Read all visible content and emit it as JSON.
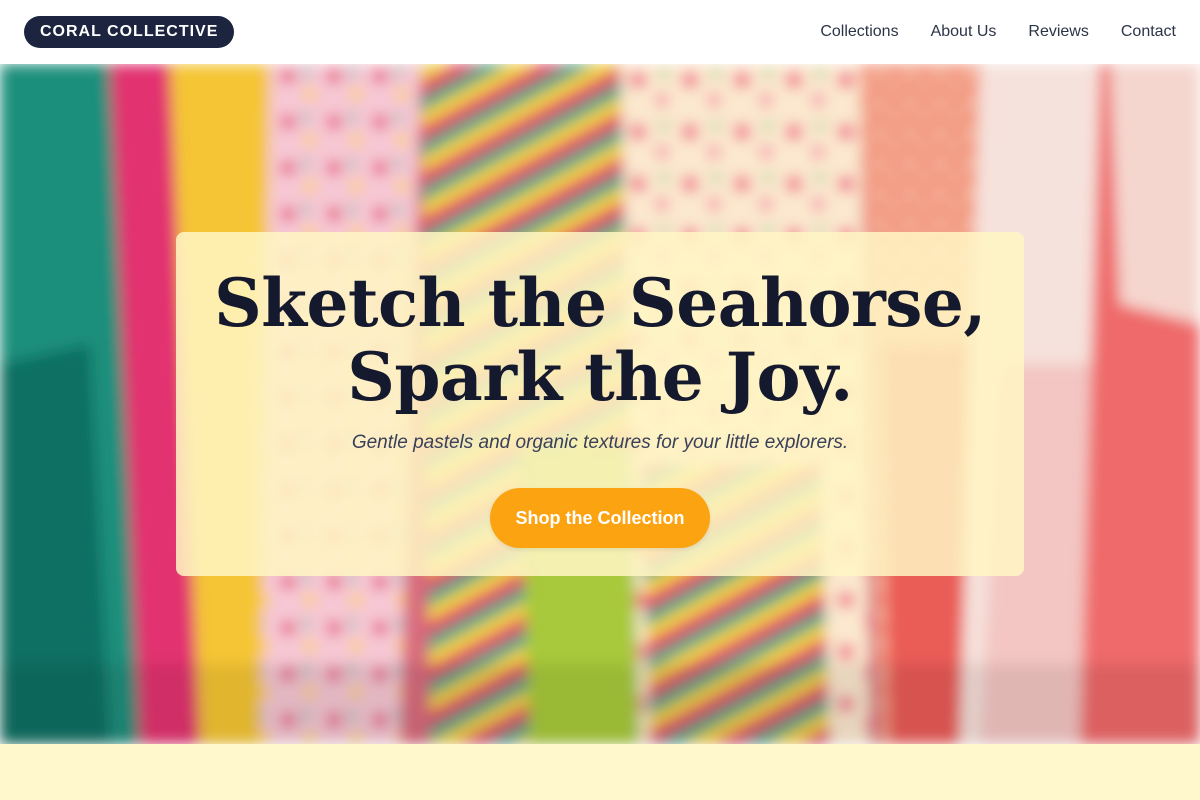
{
  "nav": {
    "logo": "CORAL COLLECTIVE",
    "links": [
      "Collections",
      "About Us",
      "Reviews",
      "Contact"
    ]
  },
  "hero": {
    "headline_line1": "Sketch the Seahorse,",
    "headline_line2": "Spark the Joy.",
    "subheadline": "Gentle pastels and organic textures for your little explorers.",
    "cta_label": "Shop the Collection",
    "background_image": "blurred-clothing-rack-photo"
  },
  "colors": {
    "logo_bg": "#1c2440",
    "cta": "#fca311",
    "card_bg": "#fff6c4",
    "headline": "#14192e",
    "bottom_band": "#fff8cc"
  }
}
